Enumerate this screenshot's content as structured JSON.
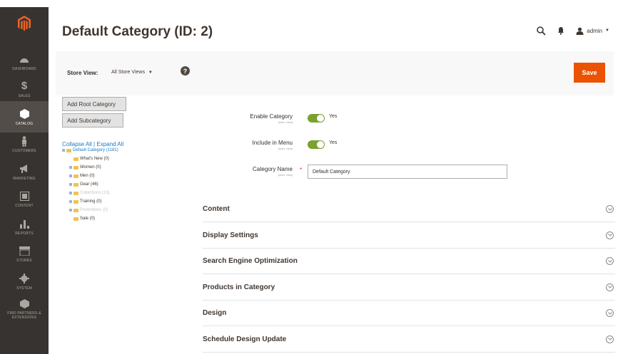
{
  "sidebar": {
    "items": [
      {
        "label": "DASHBOARD",
        "icon": "dashboard-icon"
      },
      {
        "label": "SALES",
        "icon": "dollar-icon"
      },
      {
        "label": "CATALOG",
        "icon": "cube-icon"
      },
      {
        "label": "CUSTOMERS",
        "icon": "person-icon"
      },
      {
        "label": "MARKETING",
        "icon": "megaphone-icon"
      },
      {
        "label": "CONTENT",
        "icon": "content-icon"
      },
      {
        "label": "REPORTS",
        "icon": "bar-chart-icon"
      },
      {
        "label": "STORES",
        "icon": "store-icon"
      },
      {
        "label": "SYSTEM",
        "icon": "gear-icon"
      },
      {
        "label": "FIND PARTNERS & EXTENSIONS",
        "icon": "partners-icon"
      }
    ],
    "active_index": 2
  },
  "header": {
    "title": "Default Category (ID: 2)",
    "admin_label": "admin"
  },
  "store_bar": {
    "label": "Store View:",
    "selected": "All Store Views",
    "help": "?",
    "save_label": "Save"
  },
  "tree": {
    "add_root_label": "Add Root Category",
    "add_sub_label": "Add Subcategory",
    "collapse_label": "Collapse All",
    "separator": "|",
    "expand_label": "Expand All",
    "nodes": [
      {
        "label": "Default Category (1181)",
        "state": "selected",
        "plus": true,
        "indent": 0
      },
      {
        "label": "What's New (0)",
        "state": "normal",
        "plus": false,
        "indent": 1
      },
      {
        "label": "Women (0)",
        "state": "normal",
        "plus": true,
        "indent": 1
      },
      {
        "label": "Men (0)",
        "state": "normal",
        "plus": true,
        "indent": 1
      },
      {
        "label": "Gear (46)",
        "state": "normal",
        "plus": true,
        "indent": 1
      },
      {
        "label": "Collections (13)",
        "state": "faded",
        "plus": true,
        "indent": 1
      },
      {
        "label": "Training (0)",
        "state": "normal",
        "plus": true,
        "indent": 1
      },
      {
        "label": "Promotions (0)",
        "state": "faded",
        "plus": true,
        "indent": 1
      },
      {
        "label": "Sale (0)",
        "state": "normal",
        "plus": false,
        "indent": 1
      }
    ]
  },
  "form": {
    "enable_label": "Enable Category",
    "enable_scope": "[store view]",
    "enable_value": "Yes",
    "menu_label": "Include in Menu",
    "menu_scope": "[store view]",
    "menu_value": "Yes",
    "name_label": "Category Name",
    "name_scope": "[store view]",
    "name_required": "*",
    "name_value": "Default Category"
  },
  "sections": [
    "Content",
    "Display Settings",
    "Search Engine Optimization",
    "Products in Category",
    "Design",
    "Schedule Design Update"
  ],
  "colors": {
    "sidebar": "#373330",
    "accent": "#eb5202",
    "toggle_on": "#79a22e",
    "link": "#1979c3"
  }
}
